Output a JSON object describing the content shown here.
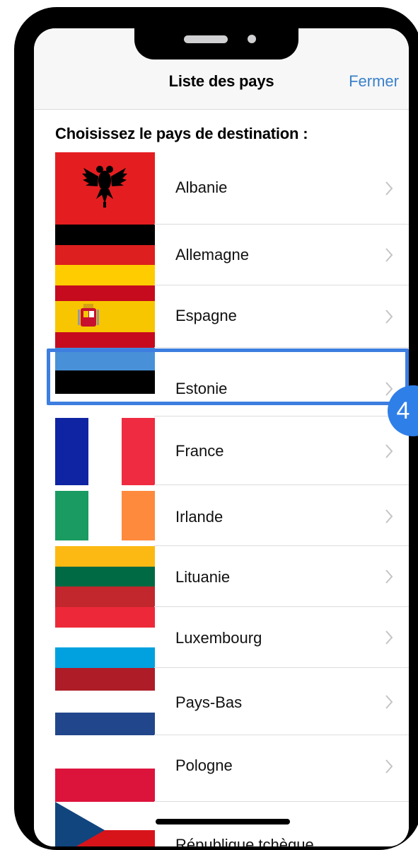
{
  "header": {
    "title": "Liste des pays",
    "close_label": "Fermer"
  },
  "section_title": "Choisissez le pays de destination :",
  "countries": [
    {
      "name": "Albanie",
      "flag_icon": "albania-flag-icon"
    },
    {
      "name": "Allemagne",
      "flag_icon": "germany-flag-icon"
    },
    {
      "name": "Espagne",
      "flag_icon": "spain-flag-icon"
    },
    {
      "name": "Estonie",
      "flag_icon": "estonia-flag-icon"
    },
    {
      "name": "France",
      "flag_icon": "france-flag-icon"
    },
    {
      "name": "Irlande",
      "flag_icon": "ireland-flag-icon"
    },
    {
      "name": "Lituanie",
      "flag_icon": "lithuania-flag-icon"
    },
    {
      "name": "Luxembourg",
      "flag_icon": "luxembourg-flag-icon"
    },
    {
      "name": "Pays-Bas",
      "flag_icon": "netherlands-flag-icon"
    },
    {
      "name": "Pologne",
      "flag_icon": "poland-flag-icon"
    },
    {
      "name": "République tchèque",
      "flag_icon": "czech-flag-icon"
    }
  ],
  "step_badge": "4",
  "colors": {
    "accent": "#3b82c8",
    "highlight": "#3d7ee0",
    "badge": "#2f7fe8"
  }
}
